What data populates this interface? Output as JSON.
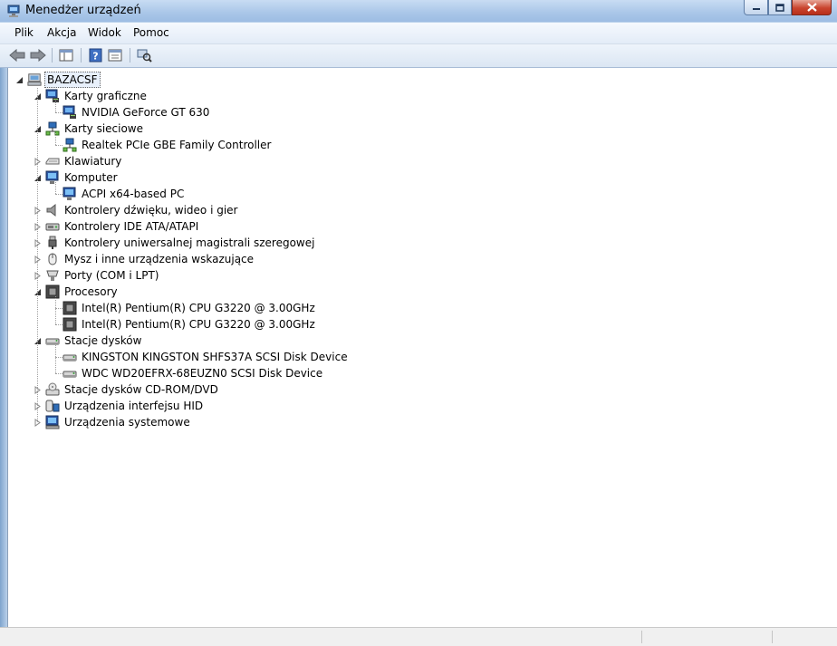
{
  "window": {
    "title": "Menedżer urządzeń",
    "icon": "device-manager-icon"
  },
  "menu": [
    "Plik",
    "Akcja",
    "Widok",
    "Pomoc"
  ],
  "toolbar": [
    {
      "name": "back-button",
      "icon": "arrow-left-icon"
    },
    {
      "name": "forward-button",
      "icon": "arrow-right-icon"
    },
    {
      "name": "show-hide-console-tree-button",
      "icon": "console-tree-icon"
    },
    {
      "name": "help-button",
      "icon": "help-icon"
    },
    {
      "name": "properties-button",
      "icon": "properties-icon"
    },
    {
      "name": "scan-hardware-button",
      "icon": "scan-hardware-icon"
    }
  ],
  "tree": {
    "root": "BAZACSF",
    "categories": [
      {
        "label": "Karty graficzne",
        "icon": "display-adapter-icon",
        "expanded": true,
        "children": [
          {
            "label": "NVIDIA GeForce GT 630",
            "icon": "display-adapter-icon"
          }
        ]
      },
      {
        "label": "Karty sieciowe",
        "icon": "network-adapter-icon",
        "expanded": true,
        "children": [
          {
            "label": "Realtek PCIe GBE Family Controller",
            "icon": "network-adapter-icon"
          }
        ]
      },
      {
        "label": "Klawiatury",
        "icon": "keyboard-icon",
        "expanded": false,
        "children": []
      },
      {
        "label": "Komputer",
        "icon": "computer-icon",
        "expanded": true,
        "children": [
          {
            "label": "ACPI x64-based PC",
            "icon": "computer-icon"
          }
        ]
      },
      {
        "label": "Kontrolery dźwięku, wideo i gier",
        "icon": "speaker-icon",
        "expanded": false,
        "children": []
      },
      {
        "label": "Kontrolery IDE ATA/ATAPI",
        "icon": "ide-controller-icon",
        "expanded": false,
        "children": []
      },
      {
        "label": "Kontrolery uniwersalnej magistrali szeregowej",
        "icon": "usb-icon",
        "expanded": false,
        "children": []
      },
      {
        "label": "Mysz i inne urządzenia wskazujące",
        "icon": "mouse-icon",
        "expanded": false,
        "children": []
      },
      {
        "label": "Porty (COM i LPT)",
        "icon": "port-icon",
        "expanded": false,
        "children": []
      },
      {
        "label": "Procesory",
        "icon": "processor-icon",
        "expanded": true,
        "children": [
          {
            "label": "Intel(R) Pentium(R) CPU G3220 @ 3.00GHz",
            "icon": "processor-icon"
          },
          {
            "label": "Intel(R) Pentium(R) CPU G3220 @ 3.00GHz",
            "icon": "processor-icon"
          }
        ]
      },
      {
        "label": "Stacje dysków",
        "icon": "disk-drive-icon",
        "expanded": true,
        "children": [
          {
            "label": "KINGSTON KINGSTON SHFS37A SCSI Disk Device",
            "icon": "disk-drive-icon"
          },
          {
            "label": "WDC WD20EFRX-68EUZN0 SCSI Disk Device",
            "icon": "disk-drive-icon"
          }
        ]
      },
      {
        "label": "Stacje dysków CD-ROM/DVD",
        "icon": "cdrom-icon",
        "expanded": false,
        "children": []
      },
      {
        "label": "Urządzenia interfejsu HID",
        "icon": "hid-icon",
        "expanded": false,
        "children": []
      },
      {
        "label": "Urządzenia systemowe",
        "icon": "system-devices-icon",
        "expanded": false,
        "children": []
      }
    ]
  }
}
